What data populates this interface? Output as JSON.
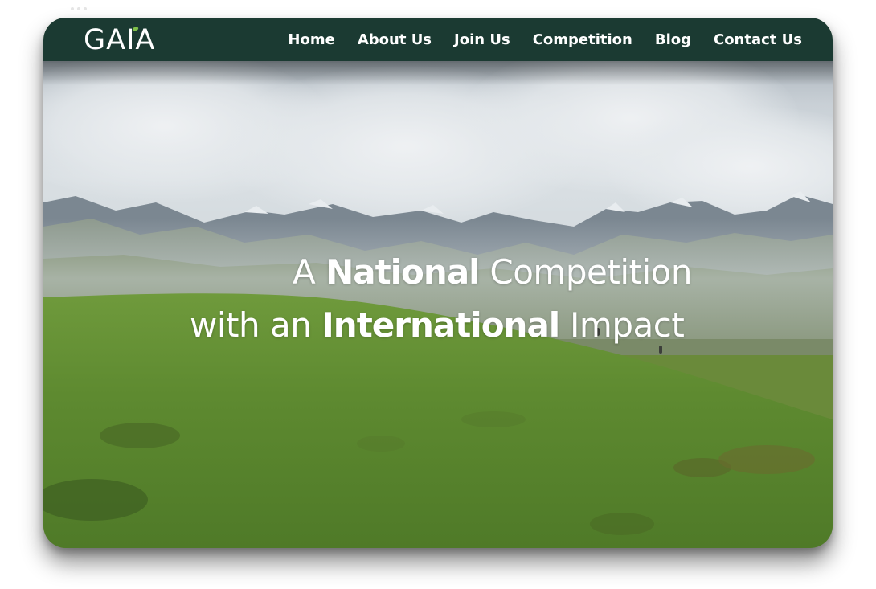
{
  "site": {
    "logo_text": "GAIA"
  },
  "nav": {
    "items": [
      {
        "label": "Home"
      },
      {
        "label": "About Us"
      },
      {
        "label": "Join Us"
      },
      {
        "label": "Competition"
      },
      {
        "label": "Blog"
      },
      {
        "label": "Contact Us"
      }
    ]
  },
  "hero": {
    "line1_a": "A ",
    "line1_bold": "National",
    "line1_b": " Competition",
    "line2_a": "with an ",
    "line2_bold": "International",
    "line2_b": " Impact"
  },
  "colors": {
    "nav_background": "#1b3a32",
    "logo_accent": "#7fc04a",
    "text": "#ffffff"
  }
}
